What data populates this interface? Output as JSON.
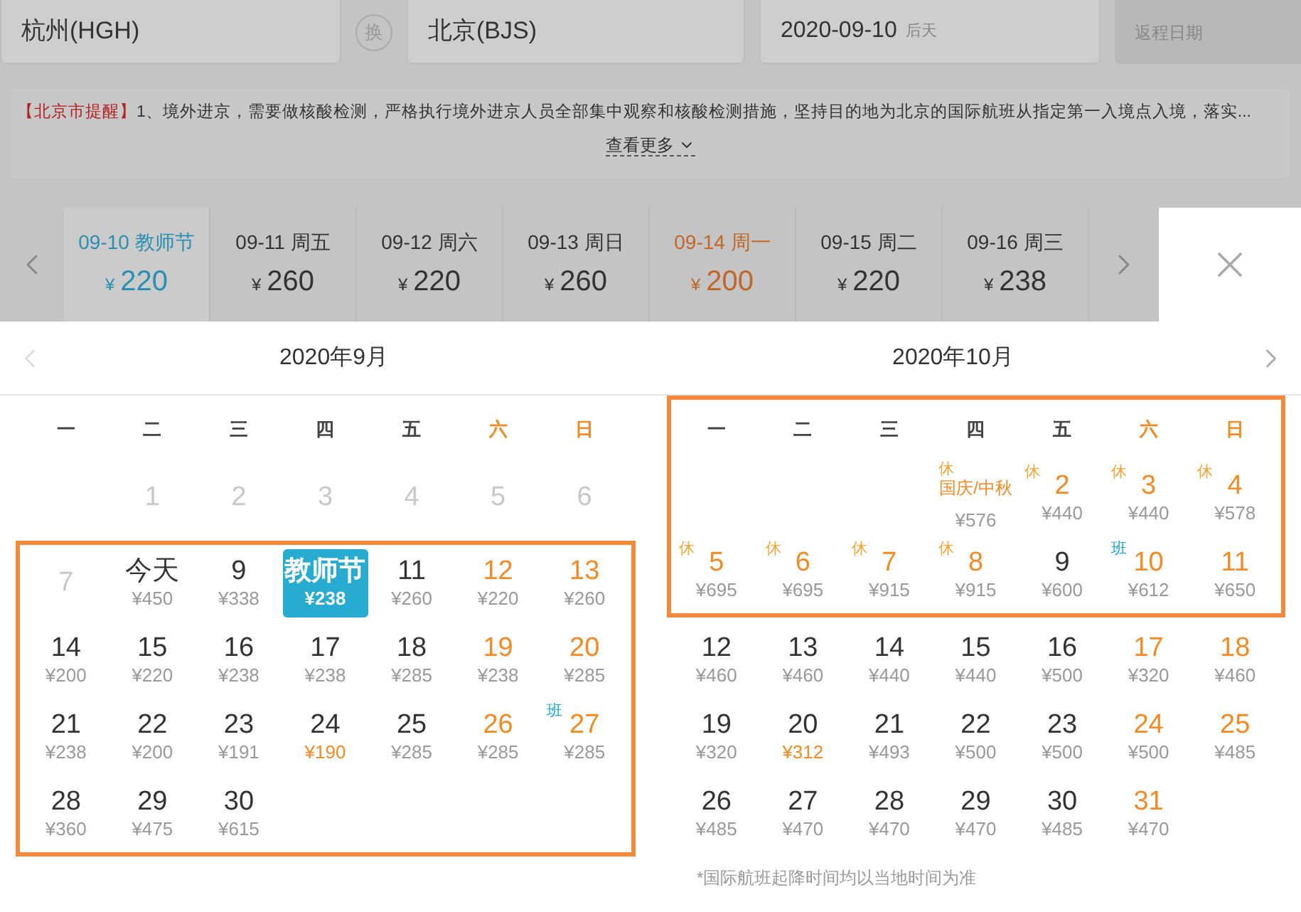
{
  "search": {
    "from": "杭州(HGH)",
    "swap": "换",
    "to": "北京(BJS)",
    "date": "2020-09-10",
    "date_hint": "后天",
    "return_placeholder": "返程日期"
  },
  "notice": {
    "text": "【北京市提醒】",
    "body": "1、境外进京，需要做核酸检测，严格执行境外进京人员全部集中观察和核酸检测措施，坚持目的地为北京的国际航班从指定第一入境点入境，落实...",
    "more": "查看更多"
  },
  "date_strip": [
    {
      "date": "09-10",
      "weekday": "教师节",
      "currency": "¥",
      "price": "220",
      "selected": true,
      "lowest": false
    },
    {
      "date": "09-11",
      "weekday": "周五",
      "currency": "¥",
      "price": "260",
      "selected": false,
      "lowest": false
    },
    {
      "date": "09-12",
      "weekday": "周六",
      "currency": "¥",
      "price": "220",
      "selected": false,
      "lowest": false
    },
    {
      "date": "09-13",
      "weekday": "周日",
      "currency": "¥",
      "price": "260",
      "selected": false,
      "lowest": false
    },
    {
      "date": "09-14",
      "weekday": "周一",
      "currency": "¥",
      "price": "200",
      "selected": false,
      "lowest": true
    },
    {
      "date": "09-15",
      "weekday": "周二",
      "currency": "¥",
      "price": "220",
      "selected": false,
      "lowest": false
    },
    {
      "date": "09-16",
      "weekday": "周三",
      "currency": "¥",
      "price": "238",
      "selected": false,
      "lowest": false
    }
  ],
  "months": [
    {
      "title": "2020年9月",
      "arrow": {
        "kind": "prev",
        "disabled": true
      },
      "weekdays": {
        "highlighted": false,
        "days": [
          {
            "label": "一",
            "off_day": false
          },
          {
            "label": "二",
            "off_day": false
          },
          {
            "label": "三",
            "off_day": false
          },
          {
            "label": "四",
            "off_day": false
          },
          {
            "label": "五",
            "off_day": false
          },
          {
            "label": "六",
            "off_day": true
          },
          {
            "label": "日",
            "off_day": true
          }
        ]
      },
      "rows": [
        {
          "highlighted": false,
          "cells": [
            null,
            {
              "kind": "past",
              "label": "1",
              "selected": false
            },
            {
              "kind": "past",
              "label": "2",
              "selected": false
            },
            {
              "kind": "past",
              "label": "3",
              "selected": false
            },
            {
              "kind": "past",
              "label": "4",
              "selected": false
            },
            {
              "kind": "past",
              "label": "5",
              "selected": false
            },
            {
              "kind": "past",
              "label": "6",
              "selected": false
            }
          ]
        },
        {
          "highlighted": true,
          "cells": [
            {
              "kind": "past",
              "label": "7",
              "selected": false
            },
            {
              "kind": "normal",
              "label": "今天",
              "price": "¥450",
              "selected": false,
              "lowest": false
            },
            {
              "kind": "normal",
              "label": "9",
              "price": "¥338",
              "selected": false,
              "lowest": false
            },
            {
              "kind": "normal",
              "label": "教师节",
              "price": "¥238",
              "selected": true
            },
            {
              "kind": "normal",
              "label": "11",
              "price": "¥260",
              "selected": false,
              "lowest": false
            },
            {
              "kind": "off",
              "label": "12",
              "price": "¥220",
              "selected": false,
              "lowest": false
            },
            {
              "kind": "off",
              "label": "13",
              "price": "¥260",
              "selected": false,
              "lowest": false
            }
          ]
        },
        {
          "highlighted": true,
          "cells": [
            {
              "kind": "normal",
              "label": "14",
              "price": "¥200",
              "selected": false,
              "lowest": false
            },
            {
              "kind": "normal",
              "label": "15",
              "price": "¥220",
              "selected": false,
              "lowest": false
            },
            {
              "kind": "normal",
              "label": "16",
              "price": "¥238",
              "selected": false,
              "lowest": false
            },
            {
              "kind": "normal",
              "label": "17",
              "price": "¥238",
              "selected": false,
              "lowest": false
            },
            {
              "kind": "normal",
              "label": "18",
              "price": "¥285",
              "selected": false,
              "lowest": false
            },
            {
              "kind": "off",
              "label": "19",
              "price": "¥238",
              "selected": false,
              "lowest": false
            },
            {
              "kind": "off",
              "label": "20",
              "price": "¥285",
              "selected": false,
              "lowest": false
            }
          ]
        },
        {
          "highlighted": true,
          "cells": [
            {
              "kind": "normal",
              "label": "21",
              "price": "¥238",
              "selected": false,
              "lowest": false
            },
            {
              "kind": "normal",
              "label": "22",
              "price": "¥200",
              "selected": false,
              "lowest": false
            },
            {
              "kind": "normal",
              "label": "23",
              "price": "¥191",
              "selected": false,
              "lowest": false
            },
            {
              "kind": "normal",
              "label": "24",
              "price": "¥190",
              "selected": false,
              "lowest": true
            },
            {
              "kind": "normal",
              "label": "25",
              "price": "¥285",
              "selected": false,
              "lowest": false
            },
            {
              "kind": "off",
              "label": "26",
              "price": "¥285",
              "selected": false,
              "lowest": false
            },
            {
              "kind": "off",
              "label": "27",
              "price": "¥285",
              "selected": false,
              "lowest": false,
              "tag": {
                "text": "班",
                "kind": "work"
              }
            }
          ]
        },
        {
          "highlighted": true,
          "cells": [
            {
              "kind": "normal",
              "label": "28",
              "price": "¥360",
              "selected": false,
              "lowest": false
            },
            {
              "kind": "normal",
              "label": "29",
              "price": "¥475",
              "selected": false,
              "lowest": false
            },
            {
              "kind": "normal",
              "label": "30",
              "price": "¥615",
              "selected": false,
              "lowest": false
            }
          ]
        }
      ]
    },
    {
      "title": "2020年10月",
      "arrow": {
        "kind": "next",
        "disabled": false
      },
      "weekdays": {
        "highlighted": true,
        "days": [
          {
            "label": "一",
            "off_day": false
          },
          {
            "label": "二",
            "off_day": false
          },
          {
            "label": "三",
            "off_day": false
          },
          {
            "label": "四",
            "off_day": false
          },
          {
            "label": "五",
            "off_day": false
          },
          {
            "label": "六",
            "off_day": true
          },
          {
            "label": "日",
            "off_day": true
          }
        ]
      },
      "rows": [
        {
          "highlighted": true,
          "cells": [
            null,
            null,
            null,
            {
              "kind": "holiday",
              "label": "国庆/中秋",
              "price": "¥576",
              "selected": false,
              "lowest": false,
              "tag": {
                "text": "休",
                "kind": "rest"
              }
            },
            {
              "kind": "off",
              "label": "2",
              "price": "¥440",
              "selected": false,
              "lowest": false,
              "tag": {
                "text": "休",
                "kind": "rest"
              }
            },
            {
              "kind": "off",
              "label": "3",
              "price": "¥440",
              "selected": false,
              "lowest": false,
              "tag": {
                "text": "休",
                "kind": "rest"
              }
            },
            {
              "kind": "off",
              "label": "4",
              "price": "¥578",
              "selected": false,
              "lowest": false,
              "tag": {
                "text": "休",
                "kind": "rest"
              }
            }
          ]
        },
        {
          "highlighted": true,
          "cells": [
            {
              "kind": "off",
              "label": "5",
              "price": "¥695",
              "selected": false,
              "lowest": false,
              "tag": {
                "text": "休",
                "kind": "rest"
              }
            },
            {
              "kind": "off",
              "label": "6",
              "price": "¥695",
              "selected": false,
              "lowest": false,
              "tag": {
                "text": "休",
                "kind": "rest"
              }
            },
            {
              "kind": "off",
              "label": "7",
              "price": "¥915",
              "selected": false,
              "lowest": false,
              "tag": {
                "text": "休",
                "kind": "rest"
              }
            },
            {
              "kind": "off",
              "label": "8",
              "price": "¥915",
              "selected": false,
              "lowest": false,
              "tag": {
                "text": "休",
                "kind": "rest"
              }
            },
            {
              "kind": "normal",
              "label": "9",
              "price": "¥600",
              "selected": false,
              "lowest": false
            },
            {
              "kind": "off",
              "label": "10",
              "price": "¥612",
              "selected": false,
              "lowest": false,
              "tag": {
                "text": "班",
                "kind": "work"
              }
            },
            {
              "kind": "off",
              "label": "11",
              "price": "¥650",
              "selected": false,
              "lowest": false
            }
          ]
        },
        {
          "highlighted": false,
          "cells": [
            {
              "kind": "normal",
              "label": "12",
              "price": "¥460",
              "selected": false,
              "lowest": false
            },
            {
              "kind": "normal",
              "label": "13",
              "price": "¥460",
              "selected": false,
              "lowest": false
            },
            {
              "kind": "normal",
              "label": "14",
              "price": "¥440",
              "selected": false,
              "lowest": false
            },
            {
              "kind": "normal",
              "label": "15",
              "price": "¥440",
              "selected": false,
              "lowest": false
            },
            {
              "kind": "normal",
              "label": "16",
              "price": "¥500",
              "selected": false,
              "lowest": false
            },
            {
              "kind": "off",
              "label": "17",
              "price": "¥320",
              "selected": false,
              "lowest": false
            },
            {
              "kind": "off",
              "label": "18",
              "price": "¥460",
              "selected": false,
              "lowest": false
            }
          ]
        },
        {
          "highlighted": false,
          "cells": [
            {
              "kind": "normal",
              "label": "19",
              "price": "¥320",
              "selected": false,
              "lowest": false
            },
            {
              "kind": "normal",
              "label": "20",
              "price": "¥312",
              "selected": false,
              "lowest": true
            },
            {
              "kind": "normal",
              "label": "21",
              "price": "¥493",
              "selected": false,
              "lowest": false
            },
            {
              "kind": "normal",
              "label": "22",
              "price": "¥500",
              "selected": false,
              "lowest": false
            },
            {
              "kind": "normal",
              "label": "23",
              "price": "¥500",
              "selected": false,
              "lowest": false
            },
            {
              "kind": "off",
              "label": "24",
              "price": "¥500",
              "selected": false,
              "lowest": false
            },
            {
              "kind": "off",
              "label": "25",
              "price": "¥485",
              "selected": false,
              "lowest": false
            }
          ]
        },
        {
          "highlighted": false,
          "cells": [
            {
              "kind": "normal",
              "label": "26",
              "price": "¥485",
              "selected": false,
              "lowest": false
            },
            {
              "kind": "normal",
              "label": "27",
              "price": "¥470",
              "selected": false,
              "lowest": false
            },
            {
              "kind": "normal",
              "label": "28",
              "price": "¥470",
              "selected": false,
              "lowest": false
            },
            {
              "kind": "normal",
              "label": "29",
              "price": "¥470",
              "selected": false,
              "lowest": false
            },
            {
              "kind": "normal",
              "label": "30",
              "price": "¥485",
              "selected": false,
              "lowest": false
            },
            {
              "kind": "off",
              "label": "31",
              "price": "¥470",
              "selected": false,
              "lowest": false
            }
          ]
        }
      ]
    }
  ],
  "footnote": "*国际航班起降时间均以当地时间为准"
}
